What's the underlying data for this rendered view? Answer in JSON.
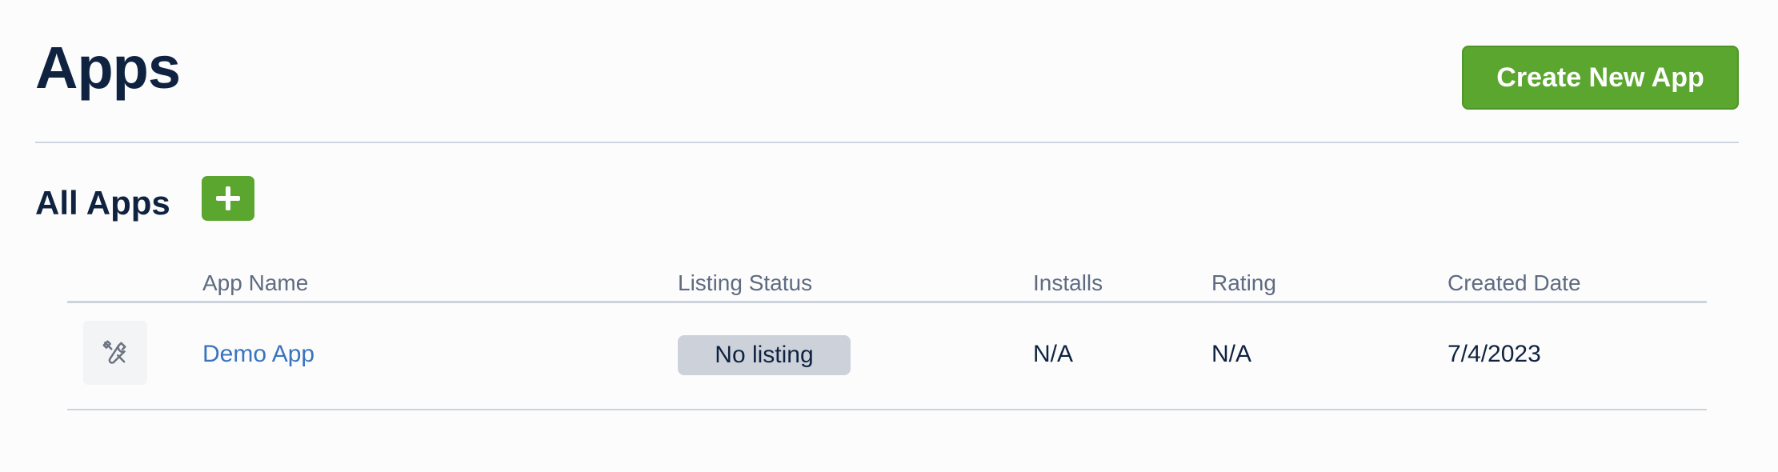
{
  "header": {
    "title": "Apps",
    "create_button_label": "Create New App"
  },
  "section": {
    "title": "All Apps",
    "add_icon": "plus-icon"
  },
  "table": {
    "columns": [
      "App Name",
      "Listing Status",
      "Installs",
      "Rating",
      "Created Date"
    ],
    "rows": [
      {
        "icon": "tools-icon",
        "app_name": "Demo App",
        "listing_status": "No listing",
        "installs": "N/A",
        "rating": "N/A",
        "created_date": "7/4/2023"
      }
    ]
  },
  "colors": {
    "accent_green": "#5aa62f",
    "link_blue": "#3a73c0",
    "heading_navy": "#0f2340",
    "badge_gray": "#cdd2da"
  }
}
